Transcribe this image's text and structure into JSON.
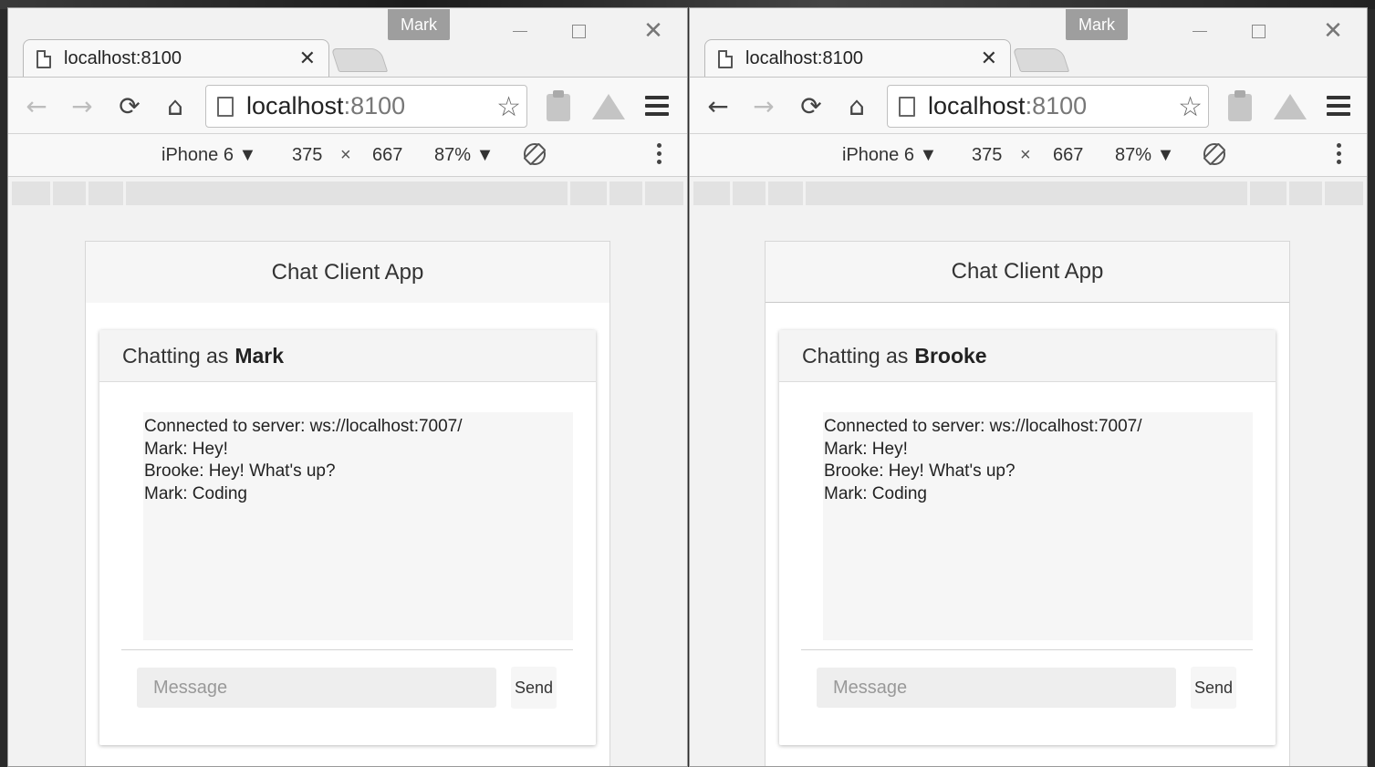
{
  "windows": [
    {
      "profile_name": "Mark",
      "tab_title": "localhost:8100",
      "url_host": "localhost",
      "url_port": ":8100",
      "back_enabled": false,
      "device": {
        "model": "iPhone 6 ▼",
        "width": "375",
        "times": "×",
        "height": "667",
        "zoom": "87% ▼"
      },
      "app_title": "Chat Client App",
      "chatting_as_label": "Chatting as",
      "user": "Mark",
      "messages": [
        "Connected to server: ws://localhost:7007/",
        "Mark: Hey!",
        "Brooke: Hey! What's up?",
        "Mark: Coding"
      ],
      "message_placeholder": "Message",
      "send_label": "Send"
    },
    {
      "profile_name": "Mark",
      "tab_title": "localhost:8100",
      "url_host": "localhost",
      "url_port": ":8100",
      "back_enabled": true,
      "device": {
        "model": "iPhone 6 ▼",
        "width": "375",
        "times": "×",
        "height": "667",
        "zoom": "87% ▼"
      },
      "app_title": "Chat Client App",
      "chatting_as_label": "Chatting as",
      "user": "Brooke",
      "messages": [
        "Connected to server: ws://localhost:7007/",
        "Mark: Hey!",
        "Brooke: Hey! What's up?",
        "Mark: Coding"
      ],
      "message_placeholder": "Message",
      "send_label": "Send"
    }
  ],
  "icons": {
    "back": "←",
    "forward": "→",
    "reload": "⟳",
    "home": "⌂",
    "star": "☆",
    "close": "✕",
    "tab_close": "✕"
  }
}
